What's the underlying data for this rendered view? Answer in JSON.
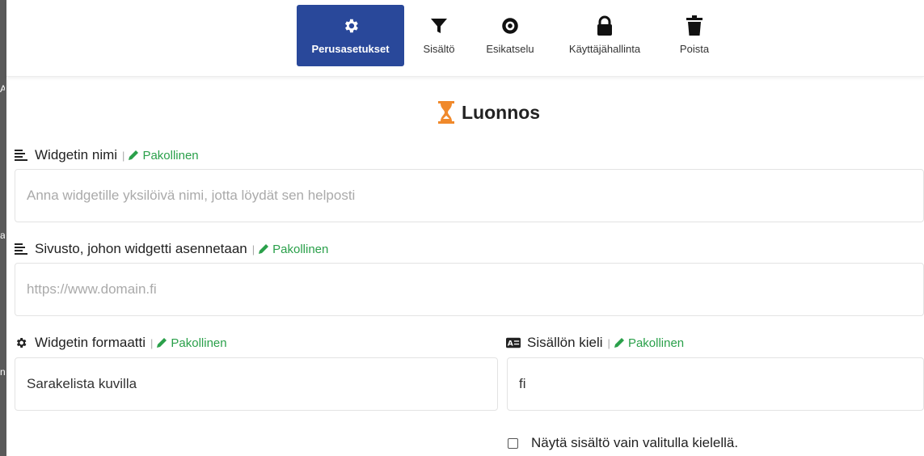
{
  "left_fragments": [
    "A",
    "a",
    "n"
  ],
  "toolbar": {
    "items": [
      {
        "label": "Perusasetukset",
        "icon": "gear-icon",
        "active": true
      },
      {
        "label": "Sisältö",
        "icon": "filter-icon",
        "active": false
      },
      {
        "label": "Esikatselu",
        "icon": "eye-icon",
        "active": false
      },
      {
        "label": "Käyttäjähallinta",
        "icon": "lock-icon",
        "active": false
      },
      {
        "label": "Poista",
        "icon": "trash-icon",
        "active": false
      }
    ]
  },
  "status": {
    "label": "Luonnos",
    "icon": "hourglass-icon",
    "color": "#f0892b"
  },
  "colors": {
    "accent": "#29489a",
    "required": "#2aa04a"
  },
  "form": {
    "required_label": "Pakollinen",
    "separator": "|",
    "widget_name": {
      "label": "Widgetin nimi",
      "placeholder": "Anna widgetille yksilöivä nimi, jotta löydät sen helposti",
      "value": ""
    },
    "site": {
      "label": "Sivusto, johon widgetti asennetaan",
      "placeholder": "https://www.domain.fi",
      "value": ""
    },
    "format": {
      "label": "Widgetin formaatti",
      "value": "Sarakelista kuvilla"
    },
    "language": {
      "label": "Sisällön kieli",
      "value": "fi"
    },
    "language_only": {
      "label": "Näytä sisältö vain valitulla kielellä.",
      "checked": false
    }
  }
}
